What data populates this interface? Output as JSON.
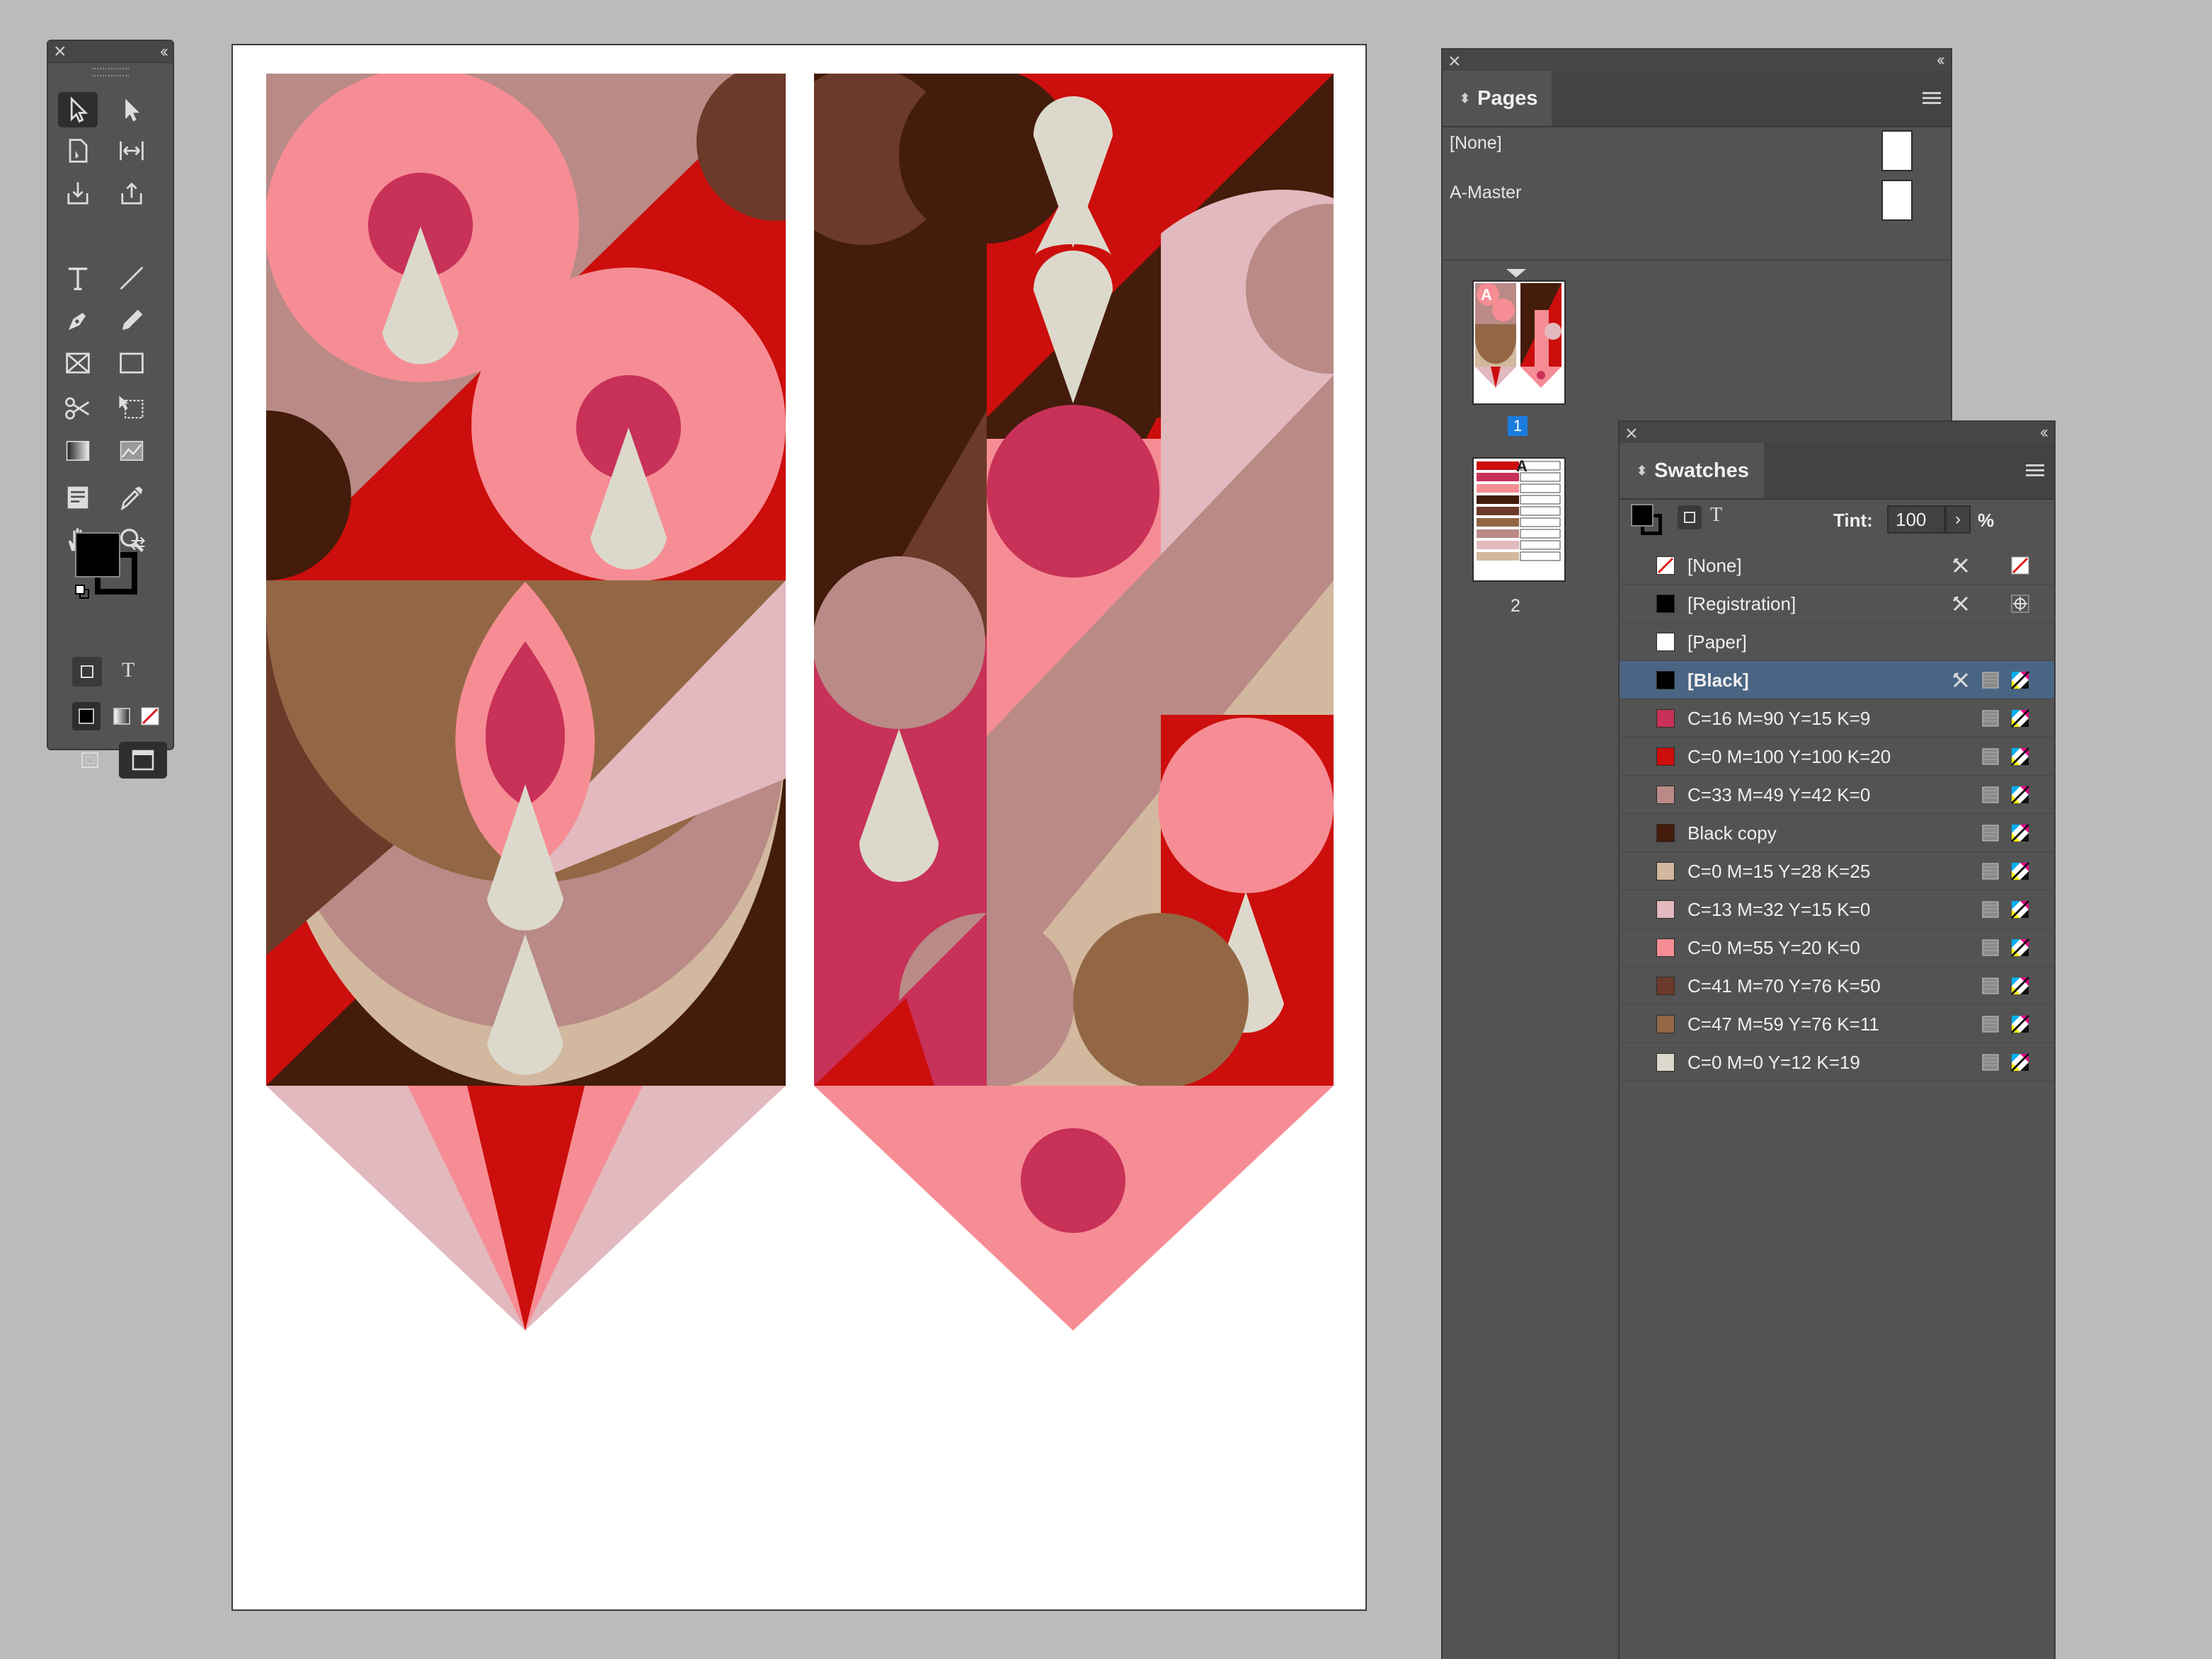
{
  "tools_panel": {
    "tools": [
      {
        "name": "selection-tool-icon"
      },
      {
        "name": "direct-selection-tool-icon"
      },
      {
        "name": "page-tool-icon"
      },
      {
        "name": "gap-tool-icon"
      },
      {
        "name": "content-collector-icon"
      },
      {
        "name": "content-placer-icon"
      },
      {
        "name": "type-tool-icon"
      },
      {
        "name": "line-tool-icon"
      },
      {
        "name": "pen-tool-icon"
      },
      {
        "name": "pencil-tool-icon"
      },
      {
        "name": "rectangle-frame-tool-icon"
      },
      {
        "name": "rectangle-tool-icon"
      },
      {
        "name": "scissors-tool-icon"
      },
      {
        "name": "free-transform-tool-icon"
      },
      {
        "name": "gradient-swatch-tool-icon"
      },
      {
        "name": "gradient-feather-tool-icon"
      },
      {
        "name": "note-tool-icon"
      },
      {
        "name": "eyedropper-tool-icon"
      },
      {
        "name": "hand-tool-icon"
      },
      {
        "name": "zoom-tool-icon"
      }
    ],
    "fill_color": "#000000",
    "stroke_color": "#000000",
    "type_toggle": "T"
  },
  "pages_panel": {
    "tab_label": "Pages",
    "masters": [
      {
        "label": "[None]"
      },
      {
        "label": "A-Master"
      }
    ],
    "pages": [
      {
        "number": "1",
        "master_letter": "A",
        "selected": true
      },
      {
        "number": "2",
        "master_letter": "A",
        "selected": false
      }
    ]
  },
  "swatches_panel": {
    "tab_label": "Swatches",
    "tint_label": "Tint:",
    "tint_value": "100",
    "tint_unit": "%",
    "text_toggle": "T",
    "swatches": [
      {
        "name": "[None]",
        "color": "none",
        "selected": false
      },
      {
        "name": "[Registration]",
        "color": "#000000",
        "selected": false
      },
      {
        "name": "[Paper]",
        "color": "#ffffff",
        "selected": false
      },
      {
        "name": "[Black]",
        "color": "#000000",
        "selected": true
      },
      {
        "name": "C=16 M=90 Y=15 K=9",
        "color": "#c83158",
        "selected": false
      },
      {
        "name": "C=0 M=100 Y=100 K=20",
        "color": "#cc0e0c",
        "selected": false
      },
      {
        "name": "C=33 M=49 Y=42 K=0",
        "color": "#b98a86",
        "selected": false
      },
      {
        "name": "Black copy",
        "color": "#431c0b",
        "selected": false
      },
      {
        "name": "C=0 M=15 Y=28 K=25",
        "color": "#d2b89e",
        "selected": false
      },
      {
        "name": "C=13 M=32 Y=15 K=0",
        "color": "#e2b9be",
        "selected": false
      },
      {
        "name": "C=0 M=55 Y=20 K=0",
        "color": "#f68d94",
        "selected": false
      },
      {
        "name": "C=41 M=70 Y=76 K=50",
        "color": "#6c3a2a",
        "selected": false
      },
      {
        "name": "C=47 M=59 Y=76 K=11",
        "color": "#936745",
        "selected": false
      },
      {
        "name": "C=0 M=0 Y=12 K=19",
        "color": "#dcd9cc",
        "selected": false
      }
    ]
  }
}
